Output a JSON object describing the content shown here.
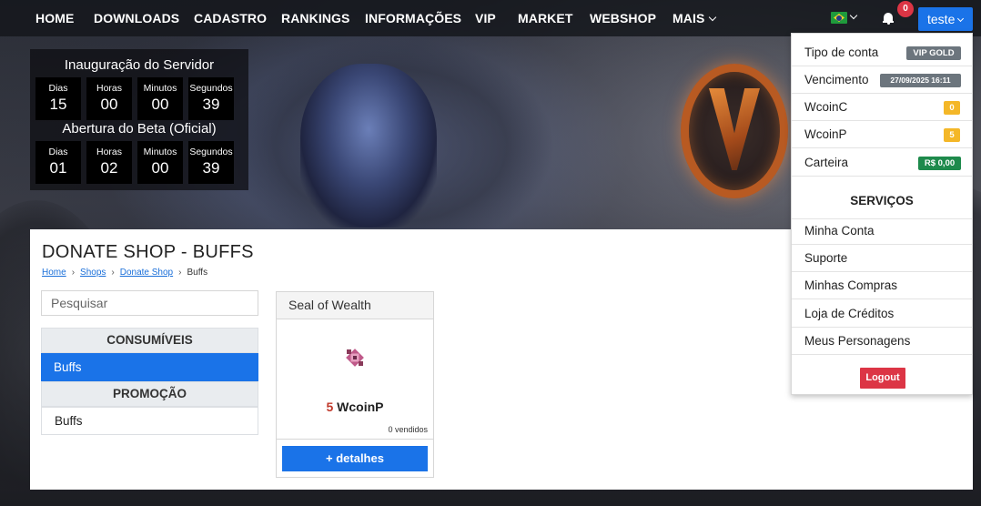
{
  "nav": {
    "items": [
      "HOME",
      "DOWNLOADS",
      "CADASTRO",
      "RANKINGS",
      "INFORMAÇÕES",
      "VIP",
      "MARKET",
      "WEBSHOP",
      "MAIS"
    ],
    "language_icon": "brazil-flag-icon",
    "notification_count": "0",
    "user_label": "teste"
  },
  "countdown": {
    "server_opening": {
      "title": "Inauguração do Servidor",
      "units": [
        {
          "label": "Dias",
          "value": "15"
        },
        {
          "label": "Horas",
          "value": "00"
        },
        {
          "label": "Minutos",
          "value": "00"
        },
        {
          "label": "Segundos",
          "value": "39"
        }
      ]
    },
    "beta_opening": {
      "title": "Abertura do Beta (Oficial)",
      "units": [
        {
          "label": "Dias",
          "value": "01"
        },
        {
          "label": "Horas",
          "value": "02"
        },
        {
          "label": "Minutos",
          "value": "00"
        },
        {
          "label": "Segundos",
          "value": "39"
        }
      ]
    }
  },
  "page": {
    "title": "DONATE SHOP - BUFFS",
    "breadcrumb": [
      "Home",
      "Shops",
      "Donate Shop",
      "Buffs"
    ]
  },
  "sidebar": {
    "search_placeholder": "Pesquisar",
    "categories": [
      {
        "heading": "CONSUMÍVEIS",
        "items": [
          "Buffs"
        ]
      },
      {
        "heading": "PROMOÇÃO",
        "items": [
          "Buffs"
        ]
      }
    ]
  },
  "product": {
    "name": "Seal of Wealth",
    "price_amount": "5",
    "price_currency": "WcoinP",
    "sold": "0 vendidos",
    "details_button": "+ detalhes"
  },
  "account_menu": {
    "rows": [
      {
        "label": "Tipo de conta",
        "badge": "VIP GOLD"
      },
      {
        "label": "Vencimento",
        "badge": "27/09/2025 16:11"
      },
      {
        "label": "WcoinC",
        "badge": "0"
      },
      {
        "label": "WcoinP",
        "badge": "5"
      },
      {
        "label": "Carteira",
        "badge": "R$ 0,00"
      }
    ],
    "services_heading": "SERVIÇOS",
    "services": [
      "Minha Conta",
      "Suporte",
      "Minhas Compras",
      "Loja de Créditos",
      "Meus Personagens"
    ],
    "logout": "Logout"
  },
  "colors": {
    "primary": "#1a73e8",
    "danger": "#dc3545",
    "warning": "#f4b728",
    "success": "#1e8a4c",
    "badge_gray": "#6c757d"
  }
}
